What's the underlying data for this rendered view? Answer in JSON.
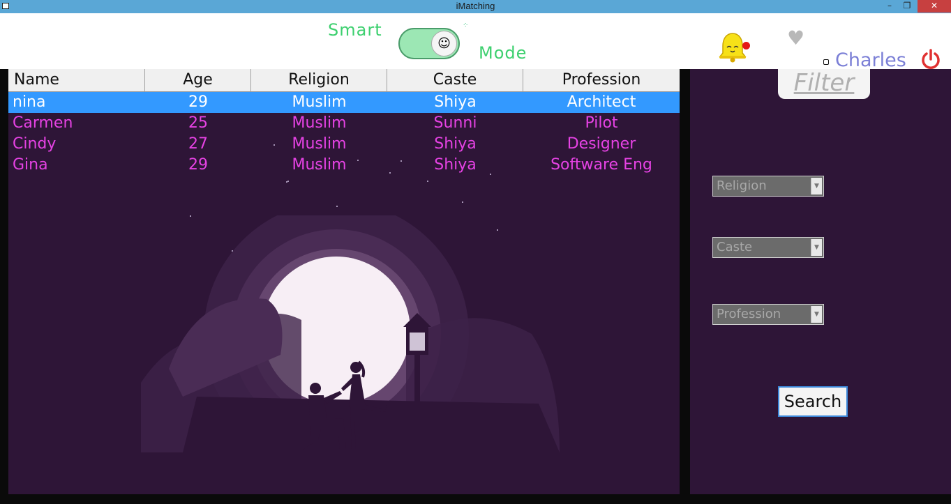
{
  "window": {
    "title": "iMatching",
    "minimize_glyph": "–",
    "maximize_glyph": "❐",
    "close_glyph": "✕"
  },
  "header": {
    "smart_label": "Smart",
    "mode_label": "Mode",
    "toggle_state": "on",
    "toggle_face": "ᵔᴥᵔ",
    "notification_badge_color": "#e41818",
    "username": "Charles",
    "accent_green": "#3dd06f",
    "username_color": "#7b7fd6",
    "power_color": "#e03131"
  },
  "table": {
    "columns": [
      "Name",
      "Age",
      "Religion",
      "Caste",
      "Profession"
    ],
    "selected_row": 0,
    "rows": [
      {
        "name": "nina",
        "age": "29",
        "religion": "Muslim",
        "caste": "Shiya",
        "profession": "Architect"
      },
      {
        "name": "Carmen",
        "age": "25",
        "religion": "Muslim",
        "caste": "Sunni",
        "profession": "Pilot"
      },
      {
        "name": "Cindy",
        "age": "27",
        "religion": "Muslim",
        "caste": "Shiya",
        "profession": "Designer"
      },
      {
        "name": "Gina",
        "age": "29",
        "religion": "Muslim",
        "caste": "Shiya",
        "profession": "Software Eng"
      }
    ],
    "row_text_color": "#e642e4",
    "selected_color": "#3399ff"
  },
  "sidebar": {
    "filter_title": "Filter",
    "religion_placeholder": "Religion",
    "caste_placeholder": "Caste",
    "profession_placeholder": "Profession",
    "search_label": "Search"
  },
  "icons": {
    "bell": "bell-icon",
    "heart": "heart-icon",
    "power": "power-icon"
  }
}
